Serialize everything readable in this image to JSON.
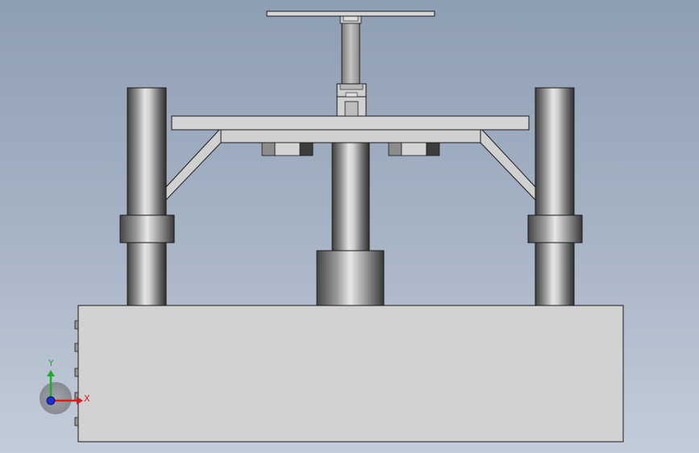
{
  "triad": {
    "x_label": "X",
    "y_label": "Y",
    "x_color": "#d81e1e",
    "y_color": "#1fae2a",
    "z_color": "#1d2fd8"
  },
  "colors": {
    "background_top": "#8e9eb3",
    "background_bottom": "#c3ccd9",
    "part_face": "#d2d2d2",
    "edge": "#1a1a1a"
  }
}
